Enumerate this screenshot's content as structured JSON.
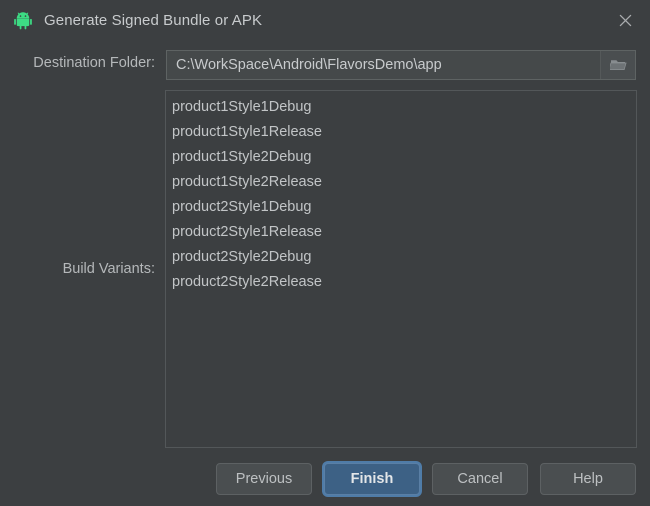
{
  "window": {
    "title": "Generate Signed Bundle or APK",
    "app_icon": "android-robot-icon",
    "close_icon": "close-icon",
    "accent_color": "#3d6185",
    "background_color": "#3c3f41",
    "android_green": "#3ddc84"
  },
  "destination": {
    "label": "Destination Folder:",
    "value": "C:\\WorkSpace\\Android\\FlavorsDemo\\app",
    "placeholder": "",
    "browse_icon": "folder-icon"
  },
  "build_variants": {
    "label": "Build Variants:",
    "items": [
      "product1Style1Debug",
      "product1Style1Release",
      "product1Style2Debug",
      "product1Style2Release",
      "product2Style1Debug",
      "product2Style1Release",
      "product2Style2Debug",
      "product2Style2Release"
    ]
  },
  "buttons": {
    "previous": "Previous",
    "finish": "Finish",
    "cancel": "Cancel",
    "help": "Help"
  }
}
